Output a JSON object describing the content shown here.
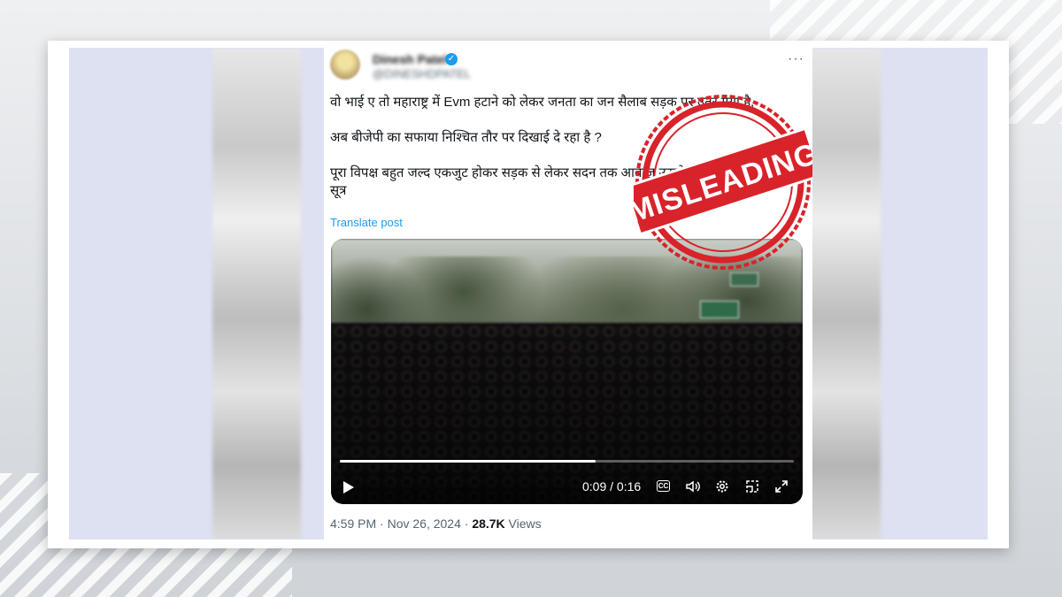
{
  "tweet": {
    "user_name": "Dinesh Patel",
    "user_handle": "@DINESHDPATEL",
    "more_label": "···",
    "lines": [
      "वो भाई ए तो महाराष्ट्र में Evm हटाने को लेकर जनता का जन सैलाब सड़क पर उतर गया है,",
      "अब बीजेपी का सफाया निश्चित तौर पर दिखाई दे रहा है ?",
      "पूरा विपक्ष बहुत जल्द एकजुट होकर सड़क से लेकर सदन तक आवाज़ उठाने की जोरदार तैयारी, सूत्र"
    ],
    "translate_label": "Translate post",
    "timestamp": "4:59 PM · Nov 26, 2024 · ",
    "views_count": "28.7K",
    "views_label": " Views"
  },
  "video": {
    "current_time": "0:09",
    "duration": "0:16",
    "time_display": "0:09 / 0:16",
    "progress": 0.5625,
    "controls": [
      "play-icon",
      "captions-icon",
      "volume-icon",
      "settings-icon",
      "pip-icon",
      "fullscreen-icon"
    ],
    "cc_label": "CC"
  },
  "stamp": {
    "text": "MISLEADING",
    "color": "#d8232a"
  },
  "colors": {
    "link": "#1d9bf0",
    "text": "#0f1419",
    "secondary": "#536471"
  }
}
